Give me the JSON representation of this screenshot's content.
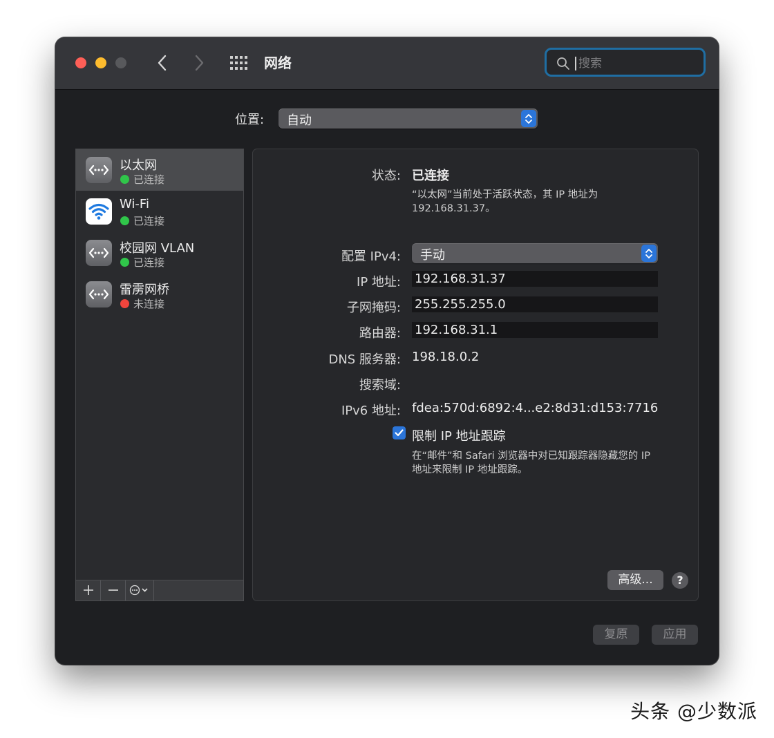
{
  "window": {
    "title": "网络"
  },
  "search": {
    "placeholder": "搜索"
  },
  "location": {
    "label": "位置:",
    "value": "自动"
  },
  "services": [
    {
      "name": "以太网",
      "status": "已连接",
      "status_color": "#30c64a",
      "icon": "ethernet-icon",
      "selected": true
    },
    {
      "name": "Wi-Fi",
      "status": "已连接",
      "status_color": "#30c64a",
      "icon": "wifi-icon",
      "selected": false
    },
    {
      "name": "校园网 VLAN",
      "status": "已连接",
      "status_color": "#30c64a",
      "icon": "ethernet-icon",
      "selected": false
    },
    {
      "name": "雷雳网桥",
      "status": "未连接",
      "status_color": "#f1453d",
      "icon": "ethernet-icon",
      "selected": false
    }
  ],
  "sidebar_toolbar": {
    "add": "+",
    "remove": "−",
    "action_icon": "ellipsis-circle-icon"
  },
  "detail": {
    "status_label": "状态:",
    "status_value": "已连接",
    "status_desc": "“以太网”当前处于活跃状态，其 IP 地址为 192.168.31.37。",
    "ipv4_label": "配置 IPv4:",
    "ipv4_value": "手动",
    "ip_label": "IP 地址:",
    "ip_value": "192.168.31.37",
    "subnet_label": "子网掩码:",
    "subnet_value": "255.255.255.0",
    "router_label": "路由器:",
    "router_value": "192.168.31.1",
    "dns_label": "DNS 服务器:",
    "dns_value": "198.18.0.2",
    "search_domain_label": "搜索域:",
    "ipv6_label": "IPv6 地址:",
    "ipv6_value": "fdea:570d:6892:4...e2:8d31:d153:7716",
    "limit_tracking_label": "限制 IP 地址跟踪",
    "limit_tracking_checked": true,
    "limit_tracking_desc": "在“邮件”和 Safari 浏览器中对已知跟踪器隐藏您的 IP 地址来限制 IP 地址跟踪。",
    "advanced_label": "高级...",
    "help_label": "?"
  },
  "footer": {
    "revert_label": "复原",
    "apply_label": "应用"
  },
  "watermark": "头条 @少数派",
  "colors": {
    "accent": "#2b75d9",
    "focus_ring": "#1f6ea3",
    "connected": "#30c64a",
    "disconnected": "#f1453d"
  }
}
